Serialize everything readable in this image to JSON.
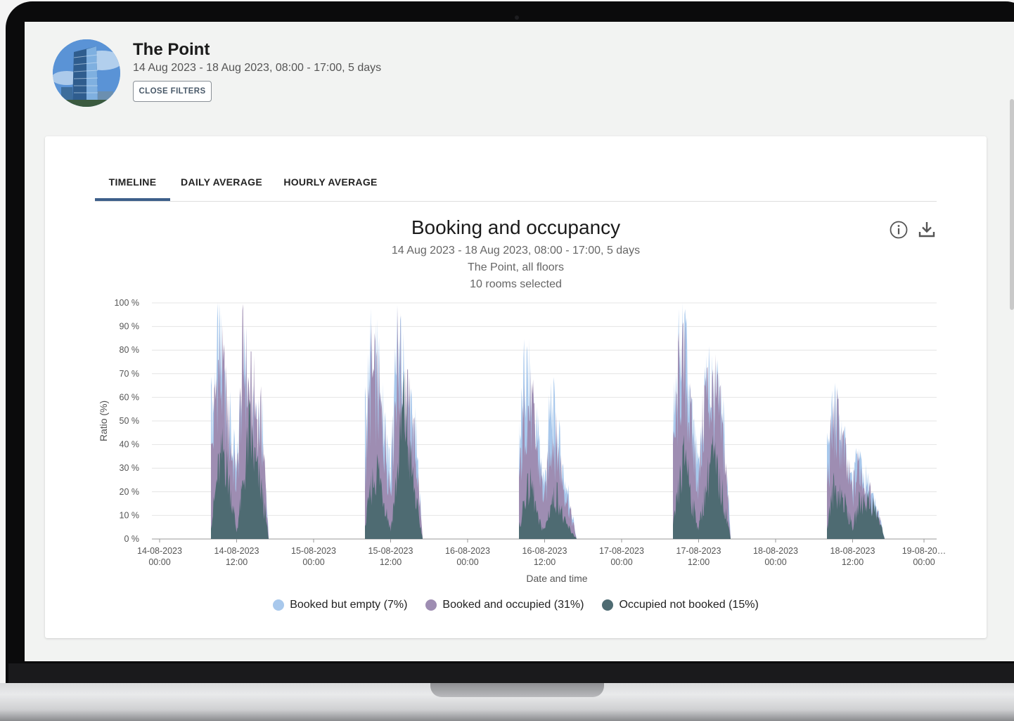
{
  "header": {
    "title": "The Point",
    "subtitle": "14 Aug 2023 - 18 Aug 2023, 08:00 - 17:00, 5 days",
    "close_filters": "CLOSE FILTERS"
  },
  "tabs": [
    {
      "label": "TIMELINE",
      "active": true
    },
    {
      "label": "DAILY AVERAGE",
      "active": false
    },
    {
      "label": "HOURLY AVERAGE",
      "active": false
    }
  ],
  "icons": {
    "info": "info-icon",
    "download": "download-icon"
  },
  "colors": {
    "booked_empty": "#a8c8ec",
    "booked_occupied": "#9e8db2",
    "occupied_not_booked": "#4e6b72",
    "tab_indicator": "#3d5f8a"
  },
  "chart_data": {
    "type": "area",
    "stacked": true,
    "title": "Booking and occupancy",
    "subtitles": [
      "14 Aug 2023 - 18 Aug 2023, 08:00 - 17:00, 5 days",
      "The Point, all floors",
      "10 rooms selected"
    ],
    "xlabel": "Date and time",
    "ylabel": "Ratio (%)",
    "ylim": [
      0,
      100
    ],
    "y_ticks": [
      "0 %",
      "10 %",
      "20 %",
      "30 %",
      "40 %",
      "50 %",
      "60 %",
      "70 %",
      "80 %",
      "90 %",
      "100 %"
    ],
    "x_ticks": [
      [
        "14-08-2023",
        "00:00"
      ],
      [
        "14-08-2023",
        "12:00"
      ],
      [
        "15-08-2023",
        "00:00"
      ],
      [
        "15-08-2023",
        "12:00"
      ],
      [
        "16-08-2023",
        "00:00"
      ],
      [
        "16-08-2023",
        "12:00"
      ],
      [
        "17-08-2023",
        "00:00"
      ],
      [
        "17-08-2023",
        "12:00"
      ],
      [
        "18-08-2023",
        "00:00"
      ],
      [
        "18-08-2023",
        "12:00"
      ],
      [
        "19-08-20…",
        "00:00"
      ]
    ],
    "grid": true,
    "legend_position": "bottom",
    "series": [
      {
        "name": "Booked but empty (7%)",
        "key": "booked_empty"
      },
      {
        "name": "Booked and occupied (31%)",
        "key": "booked_occupied"
      },
      {
        "name": "Occupied not booked (15%)",
        "key": "occupied_not_booked"
      }
    ],
    "days": [
      {
        "date": "2023-08-14",
        "x": [
          "08:00",
          "09:00",
          "10:00",
          "11:00",
          "12:00",
          "13:00",
          "14:00",
          "15:00",
          "16:00",
          "17:00"
        ],
        "occupied_not_booked": [
          6,
          35,
          50,
          28,
          4,
          30,
          60,
          40,
          25,
          0
        ],
        "booked_occupied": [
          40,
          95,
          85,
          55,
          30,
          100,
          80,
          72,
          60,
          0
        ],
        "booked_empty": [
          65,
          100,
          92,
          60,
          35,
          100,
          84,
          78,
          68,
          0
        ]
      },
      {
        "date": "2023-08-15",
        "x": [
          "08:00",
          "09:00",
          "10:00",
          "11:00",
          "12:00",
          "13:00",
          "14:00",
          "15:00",
          "16:00",
          "17:00"
        ],
        "occupied_not_booked": [
          6,
          30,
          40,
          22,
          5,
          35,
          75,
          45,
          20,
          0
        ],
        "booked_occupied": [
          40,
          90,
          80,
          55,
          30,
          100,
          85,
          65,
          45,
          0
        ],
        "booked_empty": [
          60,
          100,
          88,
          60,
          35,
          100,
          88,
          70,
          50,
          0
        ]
      },
      {
        "date": "2023-08-16",
        "x": [
          "08:00",
          "09:00",
          "10:00",
          "11:00",
          "12:00",
          "13:00",
          "14:00",
          "15:00",
          "16:00",
          "17:00"
        ],
        "occupied_not_booked": [
          5,
          25,
          30,
          10,
          5,
          20,
          25,
          10,
          5,
          0
        ],
        "booked_occupied": [
          30,
          75,
          70,
          45,
          20,
          60,
          50,
          30,
          15,
          0
        ],
        "booked_empty": [
          50,
          90,
          75,
          55,
          30,
          73,
          55,
          35,
          20,
          0
        ]
      },
      {
        "date": "2023-08-17",
        "x": [
          "08:00",
          "09:00",
          "10:00",
          "11:00",
          "12:00",
          "13:00",
          "14:00",
          "15:00",
          "16:00",
          "17:00"
        ],
        "occupied_not_booked": [
          6,
          30,
          50,
          20,
          6,
          25,
          48,
          35,
          20,
          0
        ],
        "booked_occupied": [
          40,
          92,
          90,
          55,
          30,
          80,
          80,
          72,
          50,
          0
        ],
        "booked_empty": [
          60,
          100,
          97,
          60,
          35,
          85,
          82,
          75,
          58,
          0
        ]
      },
      {
        "date": "2023-08-18",
        "x": [
          "08:00",
          "09:00",
          "10:00",
          "11:00",
          "12:00",
          "13:00",
          "14:00",
          "15:00",
          "16:00",
          "17:00"
        ],
        "occupied_not_booked": [
          6,
          28,
          26,
          18,
          6,
          20,
          22,
          20,
          12,
          0
        ],
        "booked_occupied": [
          30,
          65,
          60,
          40,
          25,
          42,
          30,
          20,
          12,
          0
        ],
        "booked_empty": [
          45,
          70,
          63,
          42,
          30,
          44,
          32,
          22,
          14,
          0
        ]
      }
    ]
  }
}
